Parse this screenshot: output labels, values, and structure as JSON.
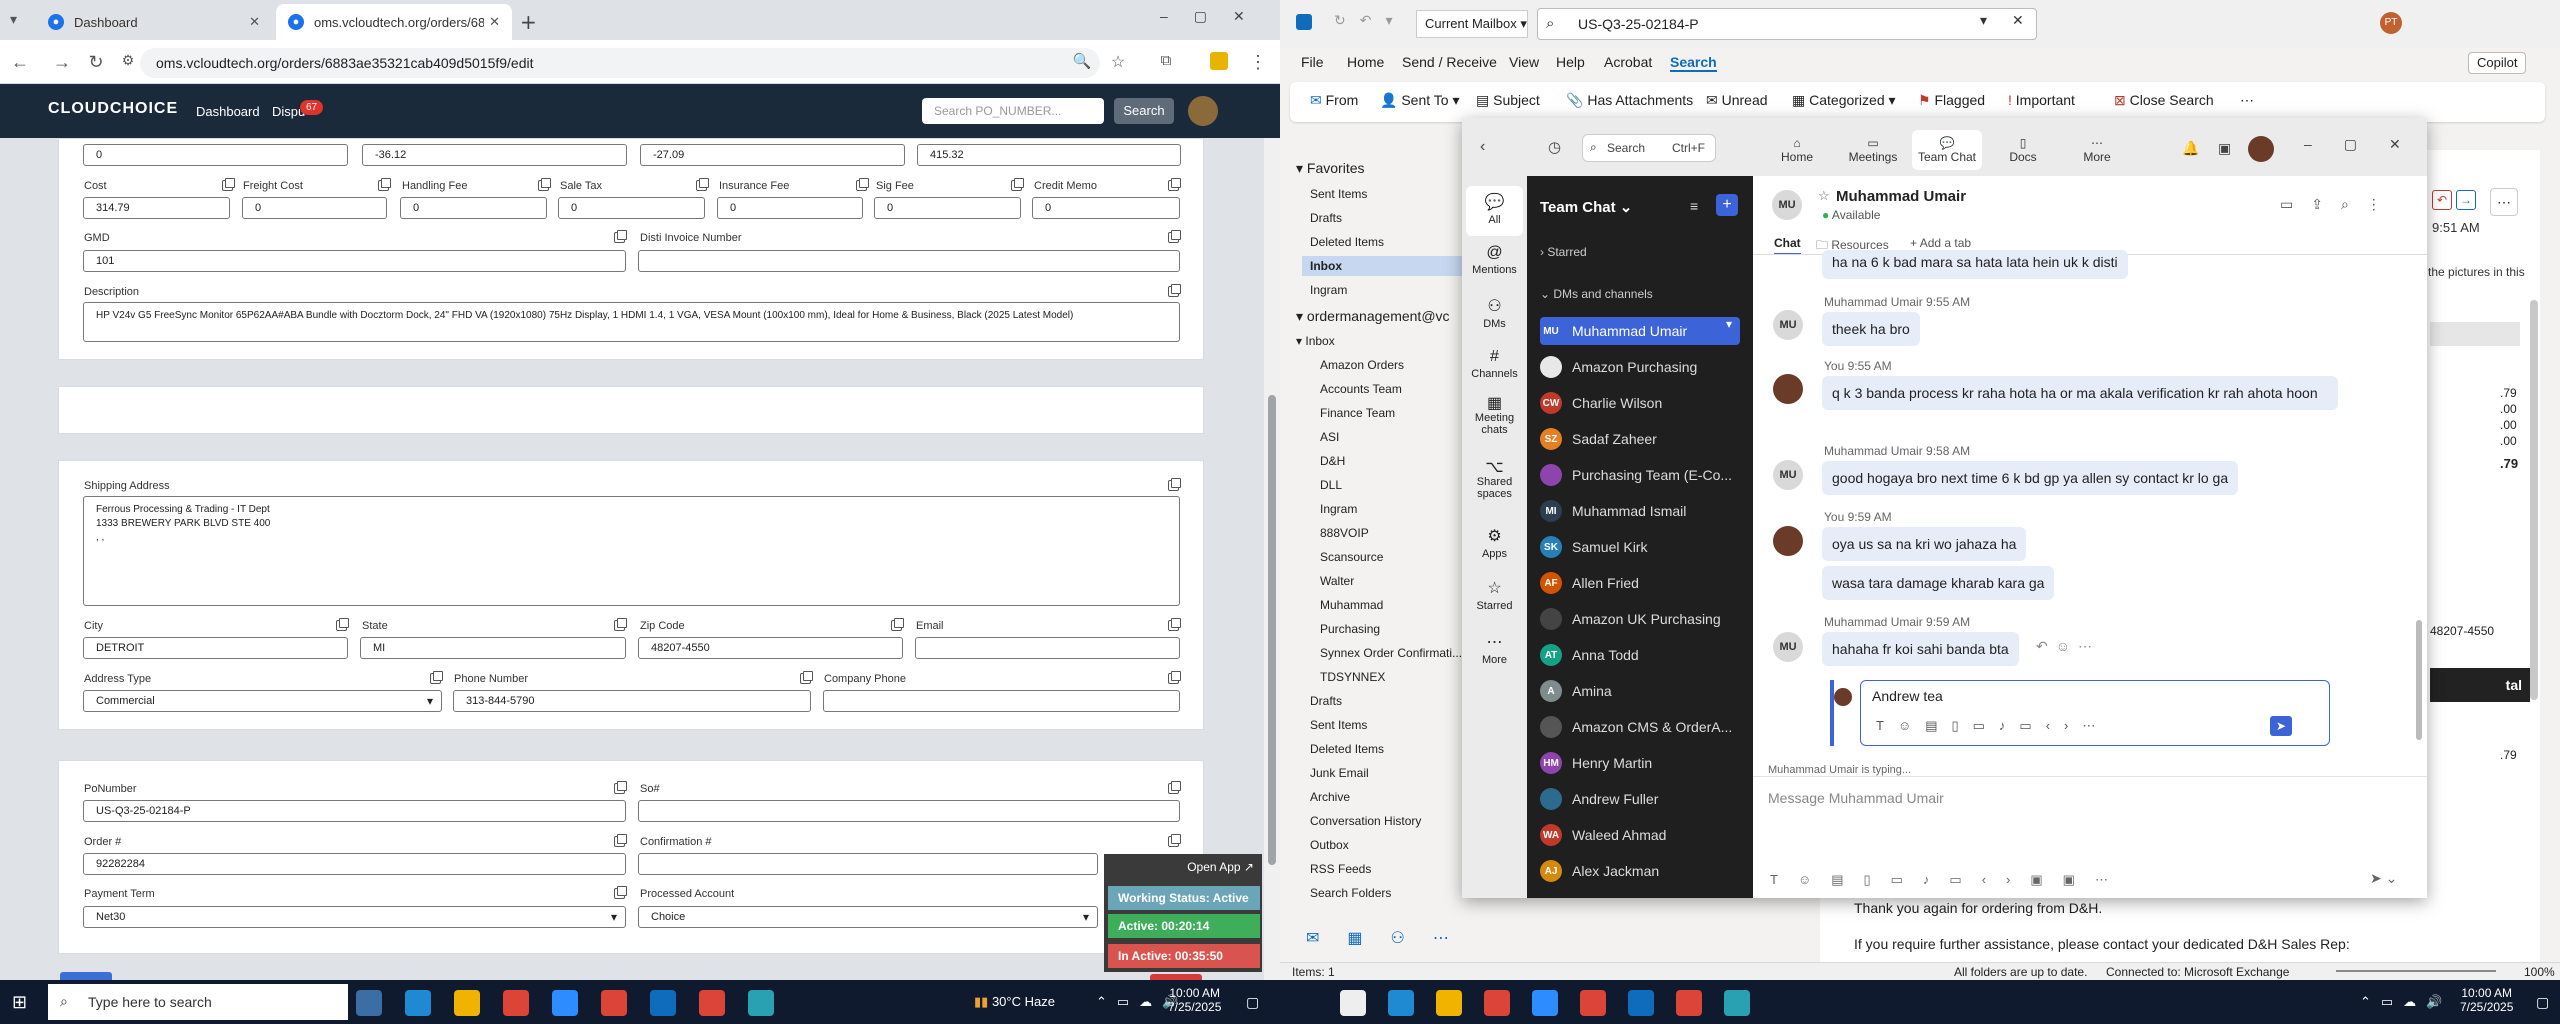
{
  "browser": {
    "tabs": [
      {
        "label": "Dashboard"
      },
      {
        "label": "oms.vcloudtech.org/orders/68"
      }
    ],
    "url": "oms.vcloudtech.org/orders/6883ae35321cab409d5015f9/edit"
  },
  "app": {
    "logo": "CLOUDCHOICE",
    "nav": [
      "Dashboard",
      "Dispu"
    ],
    "disputes_count": "67",
    "search_placeholder": "Search PO_NUMBER...",
    "search_button": "Search"
  },
  "form": {
    "top_values": [
      "0",
      "-36.12",
      "-27.09",
      "415.32"
    ],
    "fees": [
      {
        "label": "Cost",
        "value": "314.79"
      },
      {
        "label": "Freight Cost",
        "value": "0"
      },
      {
        "label": "Handling Fee",
        "value": "0"
      },
      {
        "label": "Sale Tax",
        "value": "0"
      },
      {
        "label": "Insurance Fee",
        "value": "0"
      },
      {
        "label": "Sig Fee",
        "value": "0"
      },
      {
        "label": "Credit Memo",
        "value": "0"
      }
    ],
    "gmd": {
      "label": "GMD",
      "value": "101"
    },
    "disti_invoice": {
      "label": "Disti Invoice Number",
      "value": ""
    },
    "description": {
      "label": "Description",
      "value": "HP V24v G5 FreeSync Monitor 65P62AA#ABA Bundle with Docztorm Dock, 24\" FHD VA (1920x1080) 75Hz Display, 1 HDMI 1.4, 1 VGA, VESA Mount (100x100 mm), Ideal for Home & Business, Black (2025 Latest Model)"
    },
    "shipping_address": {
      "label": "Shipping Address",
      "lines": [
        "Ferrous Processing & Trading - IT Dept",
        "1333 BREWERY PARK BLVD STE 400",
        ", ,"
      ]
    },
    "city": {
      "label": "City",
      "value": "DETROIT"
    },
    "state": {
      "label": "State",
      "value": "MI"
    },
    "zip": {
      "label": "Zip Code",
      "value": "48207-4550"
    },
    "email": {
      "label": "Email",
      "value": ""
    },
    "address_type": {
      "label": "Address Type",
      "value": "Commercial"
    },
    "phone": {
      "label": "Phone Number",
      "value": "313-844-5790"
    },
    "company_phone": {
      "label": "Company Phone",
      "value": ""
    },
    "po_number": {
      "label": "PoNumber",
      "value": "US-Q3-25-02184-P"
    },
    "so": {
      "label": "So#",
      "value": ""
    },
    "order": {
      "label": "Order #",
      "value": "92282284"
    },
    "confirmation": {
      "label": "Confirmation #",
      "value": ""
    },
    "payment_term": {
      "label": "Payment Term",
      "value": "Net30"
    },
    "processed_account": {
      "label": "Processed Account",
      "value": "Choice"
    }
  },
  "status_widget": {
    "open_app": "Open App ↗",
    "working": "Working Status: Active",
    "active": "Active: 00:20:14",
    "inactive": "In Active: 00:35:50"
  },
  "outlook": {
    "mailbox": "Current Mailbox",
    "search": "US-Q3-25-02184-P",
    "menu": [
      "File",
      "Home",
      "Send / Receive",
      "View",
      "Help",
      "Acrobat",
      "Search"
    ],
    "copilot": "Copilot",
    "ribbon": [
      "From",
      "Sent To",
      "Subject",
      "Has Attachments",
      "Unread",
      "Categorized",
      "Flagged",
      "Important",
      "Close Search"
    ],
    "favorites_header": "Favorites",
    "favorites": [
      "Sent Items",
      "Drafts",
      "Deleted Items",
      "Inbox",
      "Ingram"
    ],
    "account": "ordermanagement@vc",
    "inbox_header": "Inbox",
    "subfolders": [
      "Amazon Orders",
      "Accounts Team",
      "Finance Team",
      "ASI",
      "D&H",
      "DLL",
      "Ingram",
      "888VOIP",
      "Scansource",
      "Walter",
      "Muhammad",
      "Purchasing",
      "Synnex Order Confirmati...",
      "TDSYNNEX"
    ],
    "root_folders": [
      "Drafts",
      "Sent Items",
      "Deleted Items",
      "Junk Email",
      "Archive",
      "Conversation History",
      "Outbox",
      "RSS Feeds",
      "Search Folders"
    ],
    "reading_snippets": {
      "pictures": "the pictures in this",
      "time": "9:51 AM",
      "values": [
        ".79",
        ".00",
        ".00",
        ".00",
        ".79"
      ],
      "zip": "48207-4550",
      "total": "tal",
      "last": ".79",
      "thanks": "Thank you again for ordering from D&H.",
      "assist": "If you require further assistance, please contact your dedicated D&H Sales Rep:"
    },
    "status": {
      "items": "Items: 1",
      "sync": "All folders are up to date.",
      "connected": "Connected to: Microsoft Exchange",
      "zoom": "100%"
    }
  },
  "teams": {
    "search": "Search",
    "search_hint": "Ctrl+F",
    "top_nav": [
      "Home",
      "Meetings",
      "Team Chat",
      "Docs",
      "More"
    ],
    "rail": [
      "All",
      "Mentions",
      "DMs",
      "Channels",
      "Meeting chats",
      "Shared spaces",
      "Apps",
      "Starred",
      "More"
    ],
    "list_title": "Team Chat",
    "starred": "Starred",
    "dms_header": "DMs and channels",
    "channels": [
      {
        "initials": "MU",
        "name": "Muhammad Umair",
        "color": "#3d63d8"
      },
      {
        "initials": "",
        "name": "Amazon Purchasing",
        "color": "#e8e8e8"
      },
      {
        "initials": "CW",
        "name": "Charlie Wilson",
        "color": "#c0392b"
      },
      {
        "initials": "SZ",
        "name": "Sadaf Zaheer",
        "color": "#e67e22"
      },
      {
        "initials": "",
        "name": "Purchasing Team (E-Co...",
        "color": "#8e44ad"
      },
      {
        "initials": "MI",
        "name": "Muhammad Ismail",
        "color": "#2c3e50"
      },
      {
        "initials": "SK",
        "name": "Samuel Kirk",
        "color": "#2980b9"
      },
      {
        "initials": "AF",
        "name": "Allen Fried",
        "color": "#d35400"
      },
      {
        "initials": "",
        "name": "Amazon UK Purchasing",
        "color": "#444"
      },
      {
        "initials": "AT",
        "name": "Anna Todd",
        "color": "#16a085"
      },
      {
        "initials": "A",
        "name": "Amina",
        "color": "#7f8c8d"
      },
      {
        "initials": "",
        "name": "Amazon CMS & OrderA...",
        "color": "#555"
      },
      {
        "initials": "HM",
        "name": "Henry Martin",
        "color": "#8e44ad"
      },
      {
        "initials": "",
        "name": "Andrew Fuller",
        "color": "#2d6a8e"
      },
      {
        "initials": "WA",
        "name": "Waleed Ahmad",
        "color": "#c0392b"
      },
      {
        "initials": "AJ",
        "name": "Alex Jackman",
        "color": "#d68910"
      }
    ],
    "chat": {
      "name": "Muhammad Umair",
      "presence": "Available",
      "tabs": [
        "Chat",
        "Resources",
        "Add a tab"
      ],
      "messages": [
        {
          "who": "",
          "time": "",
          "text": "ha na 6 k bad mara sa hata lata hein uk k disti"
        },
        {
          "who": "Muhammad Umair",
          "time": "9:55 AM",
          "text": "theek ha bro"
        },
        {
          "who": "You",
          "time": "9:55 AM",
          "text": "q k 3 banda process kr raha hota ha or ma akala verification kr rah ahota hoon"
        },
        {
          "who": "Muhammad Umair",
          "time": "9:58 AM",
          "text": "good hogaya bro next time 6  k bd gp ya allen sy contact kr lo ga"
        },
        {
          "who": "You",
          "time": "9:59 AM",
          "text": "oya us sa na kri wo jahaza ha"
        },
        {
          "who": "",
          "time": "",
          "text": "wasa tara damage kharab kara ga"
        },
        {
          "who": "Muhammad Umair",
          "time": "9:59 AM",
          "text": "hahaha fr koi sahi banda bta"
        }
      ],
      "reply_draft": "Andrew tea",
      "typing": "Muhammad Umair is typing...",
      "compose_placeholder": "Message Muhammad Umair"
    }
  },
  "taskbar": {
    "search_placeholder": "Type here to search",
    "weather": "30°C Haze",
    "time_left": "10:00 AM",
    "date_left": "7/25/2025",
    "time_right": "10:00 AM",
    "date_right": "7/25/2025"
  }
}
